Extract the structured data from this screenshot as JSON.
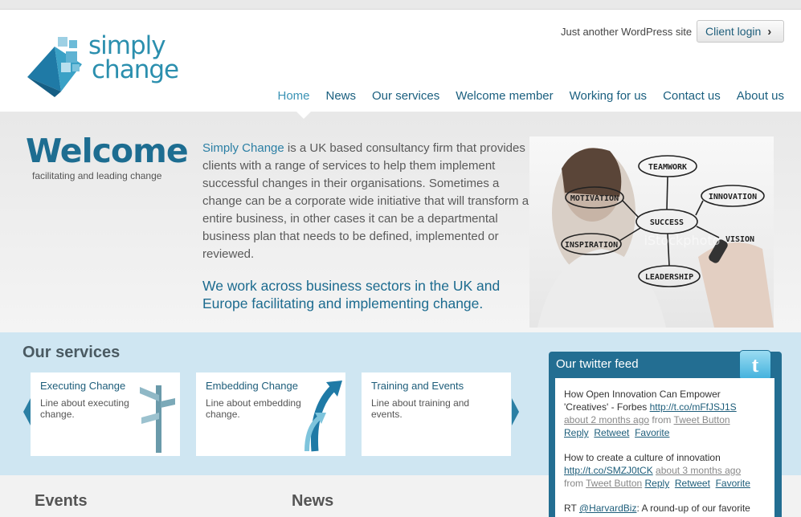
{
  "header": {
    "logo": {
      "line1": "simply",
      "line2": "change"
    },
    "tagline": "Just another WordPress site",
    "client_login": "Client login"
  },
  "nav": {
    "items": [
      {
        "label": "Home",
        "active": true
      },
      {
        "label": "News",
        "active": false
      },
      {
        "label": "Our services",
        "active": false
      },
      {
        "label": "Welcome member",
        "active": false
      },
      {
        "label": "Working for us",
        "active": false
      },
      {
        "label": "Contact us",
        "active": false
      },
      {
        "label": "About us",
        "active": false
      }
    ]
  },
  "hero": {
    "title": "Welcome",
    "subtitle": "facilitating and leading change",
    "intro_brand": "Simply Change",
    "intro_rest": " is a UK based consultancy firm that provides clients with a range of services to help them implement successful changes in their organisations. Sometimes a change can be a corporate wide initiative that will transform an entire business, in other cases it can be a departmental business plan that needs to be defined, implemented or reviewed.",
    "tagline": "We work across business sectors in the UK and Europe facilitating and implementing change.",
    "image_words": {
      "teamwork": "TEAMWORK",
      "motivation": "MOTIVATION",
      "innovation": "INNOVATION",
      "success": "SUCCESS",
      "inspiration": "INSPIRATION",
      "vision": "VISION",
      "leadership": "LEADERSHIP",
      "watermark": "iStockphoto"
    }
  },
  "services": {
    "title": "Our services",
    "cards": [
      {
        "title": "Executing Change",
        "desc": "Line about executing change.",
        "icon": "signpost-icon"
      },
      {
        "title": "Embedding Change",
        "desc": "Line about embedding change.",
        "icon": "rising-arrows-icon"
      },
      {
        "title": "Training and Events",
        "desc": "Line about training and events.",
        "icon": ""
      }
    ]
  },
  "twitter": {
    "title": "Our twitter feed",
    "bird": "t",
    "tweets": [
      {
        "text": "How Open Innovation Can Empower 'Creatives' - Forbes ",
        "link": "http://t.co/mFfJSJ1S",
        "time": "about 2 months ago",
        "from": " from ",
        "source": "Tweet Button",
        "reply": "Reply",
        "retweet": "Retweet",
        "favorite": "Favorite"
      },
      {
        "text": "How to create a culture of innovation ",
        "link": "http://t.co/SMZJ0tCK",
        "time": "about 3 months ago",
        "from": "from ",
        "source": "Tweet Button",
        "reply": "Reply",
        "retweet": "Retweet",
        "favorite": "Favorite"
      },
      {
        "prefix": "RT ",
        "mention": "@HarvardBiz",
        "text": ": A round-up of our favorite"
      }
    ]
  },
  "lower": {
    "events_title": "Events",
    "news_title": "News"
  },
  "colors": {
    "brand": "#1d6d91",
    "link": "#1d5d7a",
    "band": "#cfe6f2",
    "twitter_panel": "#236e92"
  }
}
